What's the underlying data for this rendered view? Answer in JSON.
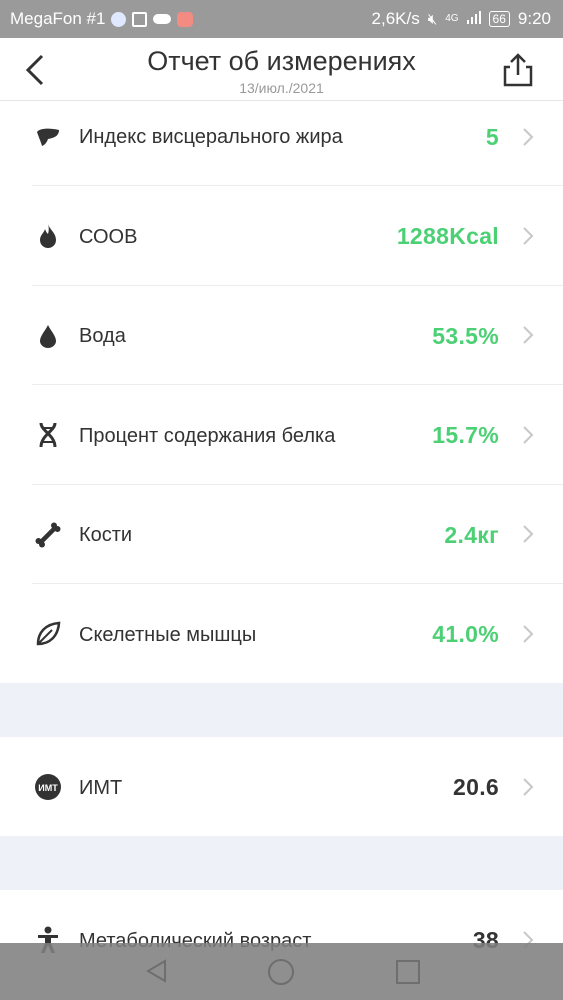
{
  "status_bar": {
    "carrier": "MegaFon #1",
    "speed": "2,6K/s",
    "network": "4G",
    "battery": "66",
    "time": "9:20"
  },
  "header": {
    "title": "Отчет об измерениях",
    "date": "13/июл./2021",
    "back_icon": "back-chevron-icon",
    "share_icon": "share-icon"
  },
  "metrics": [
    {
      "label": "Индекс висцерального жира",
      "value": "5",
      "icon": "visceral-fat-icon"
    },
    {
      "label": "СООВ",
      "value": "1288Kcal",
      "icon": "flame-icon"
    },
    {
      "label": "Вода",
      "value": "53.5%",
      "icon": "water-drop-icon"
    },
    {
      "label": "Процент содержания белка",
      "value": "15.7%",
      "icon": "dna-icon"
    },
    {
      "label": "Кости",
      "value": "2.4кг",
      "icon": "bone-icon"
    },
    {
      "label": "Скелетные мышцы",
      "value": "41.0%",
      "icon": "leaf-icon"
    }
  ],
  "bmi": {
    "label": "ИМТ",
    "icon_text": "ИМТ",
    "value": "20.6"
  },
  "metabolic_age": {
    "label": "Метаболический возраст",
    "value": "38",
    "icon": "person-icon"
  },
  "colors": {
    "accent": "#4cd074",
    "gap": "#eef2f8",
    "status_bar": "#9a9a9a"
  }
}
